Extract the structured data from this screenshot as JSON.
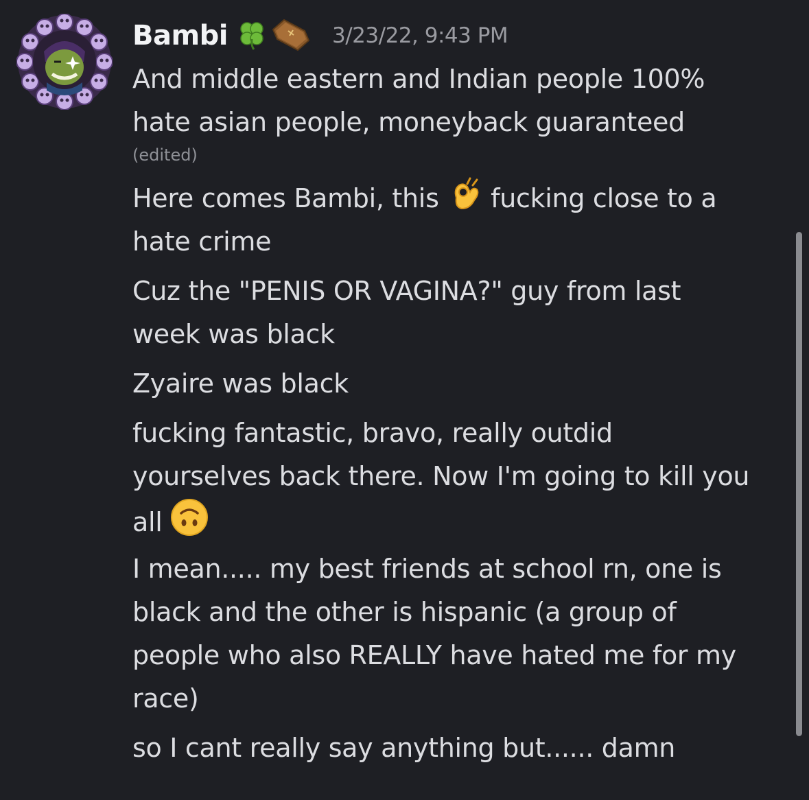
{
  "message": {
    "username": "Bambi",
    "timestamp": "3/23/22, 9:43 PM",
    "badges": [
      "four-leaf-clover-icon",
      "coffin-icon"
    ],
    "edited_label": "(edited)",
    "lines": [
      "And middle eastern and Indian people 100%",
      "hate asian people, moneyback guaranteed",
      "Here comes Bambi, this",
      "fucking close to a",
      "hate crime",
      "Cuz the \"PENIS OR VAGINA?\" guy from last",
      "week was black",
      "Zyaire was black",
      "fucking fantastic, bravo, really outdid",
      "yourselves back there. Now I'm going to kill you",
      "all",
      "I mean..... my best friends at school rn, one is",
      "black and the other is hispanic (a group of",
      "people who also REALLY have hated me for my",
      "race)",
      "so I cant really say anything but...... damn"
    ]
  },
  "colors": {
    "background": "#1e1f24",
    "text": "#dcdde1",
    "username": "#f2f3f5",
    "muted": "#9a9ba1",
    "avatar_ring": "#b79ad8",
    "avatar_face": "#6f8f3a"
  }
}
